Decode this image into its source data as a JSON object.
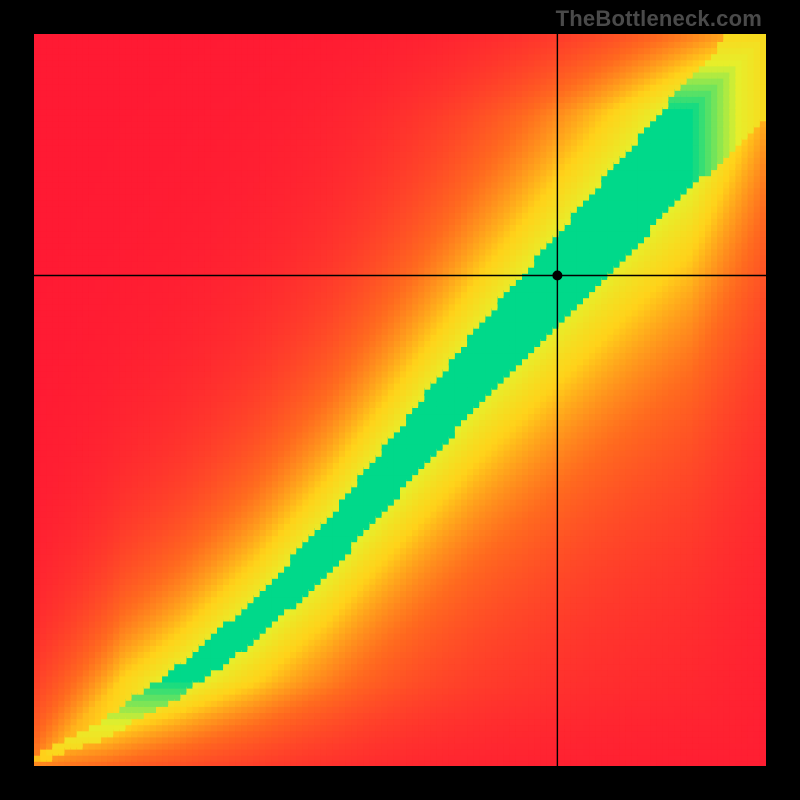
{
  "watermark": "TheBottleneck.com",
  "chart_data": {
    "type": "heatmap",
    "title": "",
    "xlabel": "",
    "ylabel": "",
    "xlim": [
      0,
      1
    ],
    "ylim": [
      0,
      1
    ],
    "grid_size": 120,
    "colormap": {
      "stops": [
        {
          "t": 0.0,
          "color": "#ff1a33"
        },
        {
          "t": 0.25,
          "color": "#ff6a1f"
        },
        {
          "t": 0.5,
          "color": "#ffd21a"
        },
        {
          "t": 0.72,
          "color": "#e6ef2b"
        },
        {
          "t": 1.0,
          "color": "#00d98a"
        }
      ]
    },
    "ridge": {
      "description": "Optimal-match diagonal band; value = 1 − normalized vertical distance from ridge center",
      "center_curve": [
        {
          "x": 0.0,
          "y": 0.01
        },
        {
          "x": 0.1,
          "y": 0.055
        },
        {
          "x": 0.2,
          "y": 0.12
        },
        {
          "x": 0.3,
          "y": 0.2
        },
        {
          "x": 0.4,
          "y": 0.3
        },
        {
          "x": 0.5,
          "y": 0.42
        },
        {
          "x": 0.6,
          "y": 0.54
        },
        {
          "x": 0.7,
          "y": 0.65
        },
        {
          "x": 0.8,
          "y": 0.76
        },
        {
          "x": 0.9,
          "y": 0.87
        },
        {
          "x": 1.0,
          "y": 0.97
        }
      ],
      "green_half_width": {
        "at_x0": 0.006,
        "at_x1": 0.085
      },
      "decay_scale": 0.42
    },
    "crosshair": {
      "x": 0.715,
      "y": 0.67
    },
    "marker": {
      "x": 0.715,
      "y": 0.67,
      "radius_px": 5,
      "color": "#000000"
    }
  }
}
